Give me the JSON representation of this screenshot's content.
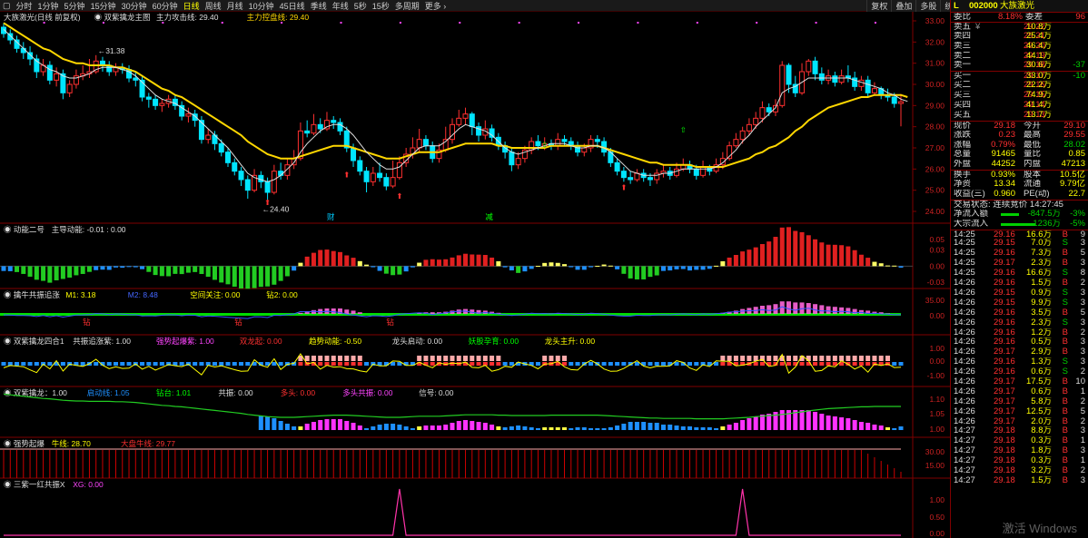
{
  "toolbar": {
    "items": [
      "▢",
      "分时",
      "1分钟",
      "5分钟",
      "15分钟",
      "30分钟",
      "60分钟",
      "日线",
      "周线",
      "月线",
      "10分钟",
      "45日线",
      "季线",
      "年线",
      "5秒",
      "15秒",
      "多周期",
      "更多 ›"
    ],
    "active": "日线",
    "right": [
      "复权",
      "叠加",
      "多股",
      "统计",
      "画线",
      "F10",
      "标记",
      "-自选",
      "返回"
    ]
  },
  "stock": {
    "marker": "L",
    "code": "002000",
    "name": "大族激光"
  },
  "panels": {
    "main": {
      "title": "大族激光(日线 前复权)",
      "legend": "◉ 双紫擒龙主图",
      "l1": "主力攻击线: 29.40",
      "l2": "主力控盘线: 29.40",
      "high": "31.38",
      "low": "24.40",
      "ticks": [
        "33.00",
        "32.00",
        "31.00",
        "30.00",
        "29.00",
        "28.00",
        "27.00",
        "26.00",
        "25.00",
        "24.00"
      ],
      "marks": [
        "财",
        "减"
      ]
    },
    "p2": {
      "title": "◉ 动能二号",
      "l1": "主导动能: -0.01 : 0.00",
      "ticks": [
        "0.05",
        "0.03",
        "0.00",
        "-0.03"
      ]
    },
    "p3": {
      "title": "◉ 擒牛共振追涨",
      "l1": "M1: 3.18",
      "l2": "M2: 8.48",
      "l3": "空间关注: 0.00",
      "l4": "钻2: 0.00",
      "ticks": [
        "35.00",
        "0.00"
      ],
      "flags": [
        "钻",
        "钻",
        "钻"
      ]
    },
    "p4": {
      "title": "◉ 双紫擒龙四合1",
      "l1": "共振追涨紫: 1.00",
      "l2": "强势起爆紫: 1.00",
      "l3": "双龙起: 0.00",
      "l4": "趋势动能: -0.50",
      "l5": "龙头启动: 0.00",
      "l6": "妖股孕育: 0.00",
      "l7": "龙头主升: 0.00",
      "ticks": [
        "1.00",
        "0.00",
        "-1.00"
      ]
    },
    "p5": {
      "title": "◉ 双紫擒龙：1.00",
      "l1": "启动线: 1.05",
      "l2": "钻台: 1.01",
      "l3": "共振: 0.00",
      "l4": "多头: 0.00",
      "l5": "多头共振: 0.00",
      "l6": "信号: 0.00",
      "ticks": [
        "1.10",
        "1.05",
        "1.00"
      ]
    },
    "p6": {
      "title": "◉ 强势起爆",
      "l1": "牛线: 28.70",
      "l2": "大盘牛线: 29.77",
      "ticks": [
        "30.00",
        "15.00"
      ]
    },
    "p7": {
      "title": "◉ 三紫一红共振X",
      "l1": "XG: 0.00",
      "ticks": [
        "1.00",
        "0.50",
        "0.00"
      ]
    }
  },
  "quote": {
    "weibi": [
      "委比",
      "8.18%",
      "委差",
      "96"
    ],
    "sell": [
      [
        "卖五",
        "¥",
        "29.22",
        "10.8万"
      ],
      [
        "卖四",
        "",
        "29.21",
        "25.4万"
      ],
      [
        "卖三",
        "",
        "29.20",
        "46.4万"
      ],
      [
        "卖二",
        "",
        "29.19",
        "44.1万"
      ],
      [
        "卖一",
        "",
        "29.18",
        "30.6万",
        "-37"
      ]
    ],
    "buy": [
      [
        "买一",
        "",
        "29.17",
        "33.0万",
        "-10"
      ],
      [
        "买二",
        "",
        "29.16",
        "22.2万"
      ],
      [
        "买三",
        "",
        "29.15",
        "74.9万"
      ],
      [
        "买四",
        "",
        "29.14",
        "41.4万"
      ],
      [
        "买五",
        "",
        "29.13",
        "13.7万"
      ]
    ],
    "stats": [
      [
        "现价",
        "29.18",
        "今开",
        "29.10"
      ],
      [
        "涨跌",
        "0.23",
        "最高",
        "29.55"
      ],
      [
        "涨幅",
        "0.79%",
        "最低",
        "28.02"
      ],
      [
        "总量",
        "91465",
        "量比",
        "0.85"
      ],
      [
        "外盘",
        "44252",
        "内盘",
        "47213"
      ],
      [
        "换手",
        "0.93%",
        "股本",
        "10.5亿"
      ],
      [
        "净资",
        "13.34",
        "流通",
        "9.79亿"
      ],
      [
        "收益(三)",
        "0.960",
        "PE(动)",
        "22.7"
      ]
    ],
    "status": "交易状态: 连续竞价 14:27:45",
    "flows": [
      [
        "净流入额",
        "-847.5万",
        "-3%"
      ],
      [
        "大宗流入",
        "-1236万",
        "-5%"
      ]
    ]
  },
  "ticks": [
    [
      "14:25",
      "29.16",
      "16.6万",
      "B",
      "9"
    ],
    [
      "14:25",
      "29.15",
      "7.0万",
      "S",
      "3"
    ],
    [
      "14:25",
      "29.16",
      "7.3万",
      "B",
      "5"
    ],
    [
      "14:25",
      "29.17",
      "2.3万",
      "B",
      "3"
    ],
    [
      "14:25",
      "29.16",
      "16.6万",
      "S",
      "8"
    ],
    [
      "14:26",
      "29.16",
      "1.5万",
      "B",
      "2"
    ],
    [
      "14:26",
      "29.15",
      "0.9万",
      "S",
      "3"
    ],
    [
      "14:26",
      "29.15",
      "9.9万",
      "S",
      "3"
    ],
    [
      "14:26",
      "29.16",
      "3.5万",
      "B",
      "5"
    ],
    [
      "14:26",
      "29.16",
      "2.3万",
      "S",
      "3"
    ],
    [
      "14:26",
      "29.16",
      "1.2万",
      "B",
      "2"
    ],
    [
      "14:26",
      "29.16",
      "0.5万",
      "B",
      "3"
    ],
    [
      "14:26",
      "29.17",
      "2.9万",
      "B",
      "3"
    ],
    [
      "14:26",
      "29.16",
      "1.3万",
      "S",
      "3"
    ],
    [
      "14:26",
      "29.16",
      "0.6万",
      "S",
      "2"
    ],
    [
      "14:26",
      "29.17",
      "17.5万",
      "B",
      "10"
    ],
    [
      "14:26",
      "29.17",
      "0.6万",
      "B",
      "1"
    ],
    [
      "14:26",
      "29.17",
      "5.8万",
      "B",
      "2"
    ],
    [
      "14:26",
      "29.17",
      "12.5万",
      "B",
      "5"
    ],
    [
      "14:26",
      "29.17",
      "2.0万",
      "B",
      "2"
    ],
    [
      "14:27",
      "29.18",
      "8.8万",
      "B",
      "3"
    ],
    [
      "14:27",
      "29.18",
      "0.3万",
      "B",
      "1"
    ],
    [
      "14:27",
      "29.18",
      "1.8万",
      "B",
      "3"
    ],
    [
      "14:27",
      "29.18",
      "0.3万",
      "B",
      "1"
    ],
    [
      "14:27",
      "29.18",
      "3.2万",
      "B",
      "2"
    ],
    [
      "14:27",
      "29.18",
      "1.5万",
      "B",
      "3"
    ]
  ],
  "watermark": "激活 Windows",
  "chart_data": {
    "type": "candlestick",
    "ylim": [
      24,
      33
    ],
    "candles": [
      [
        32.7,
        32.4,
        32.9,
        32.2
      ],
      [
        32.4,
        32.1,
        32.6,
        31.9
      ],
      [
        32.1,
        31.7,
        32.3,
        31.5
      ],
      [
        31.7,
        31.5,
        32.0,
        31.2
      ],
      [
        31.5,
        31.2,
        31.8,
        30.9
      ],
      [
        31.2,
        30.6,
        31.4,
        30.3
      ],
      [
        30.6,
        30.9,
        31.2,
        30.4
      ],
      [
        30.9,
        30.2,
        31.1,
        30.0
      ],
      [
        30.2,
        30.5,
        30.8,
        29.9
      ],
      [
        30.5,
        29.6,
        30.7,
        29.3
      ],
      [
        29.6,
        30.0,
        30.2,
        29.4
      ],
      [
        30.0,
        30.4,
        30.7,
        29.8
      ],
      [
        30.4,
        30.5,
        30.9,
        30.2
      ],
      [
        30.5,
        30.6,
        31.2,
        30.3
      ],
      [
        30.6,
        31.1,
        31.38,
        30.5
      ],
      [
        31.1,
        30.9,
        31.3,
        30.6
      ],
      [
        30.9,
        30.6,
        31.1,
        30.4
      ],
      [
        30.6,
        30.8,
        31.0,
        30.4
      ],
      [
        30.8,
        30.7,
        31.0,
        30.5
      ],
      [
        30.7,
        30.3,
        30.9,
        30.1
      ],
      [
        30.3,
        30.2,
        30.6,
        29.9
      ],
      [
        30.2,
        29.4,
        30.4,
        29.2
      ],
      [
        29.4,
        29.3,
        29.6,
        28.9
      ],
      [
        29.3,
        29.0,
        29.5,
        28.8
      ],
      [
        29.0,
        29.1,
        29.3,
        28.7
      ],
      [
        29.1,
        29.3,
        29.5,
        28.9
      ],
      [
        29.3,
        29.0,
        29.5,
        28.8
      ],
      [
        29.0,
        28.5,
        29.2,
        28.3
      ],
      [
        28.5,
        28.6,
        28.9,
        28.2
      ],
      [
        28.6,
        28.3,
        28.8,
        28.0
      ],
      [
        28.3,
        27.4,
        28.5,
        27.2
      ],
      [
        27.4,
        27.6,
        27.9,
        27.2
      ],
      [
        27.6,
        27.2,
        27.8,
        26.9
      ],
      [
        27.2,
        26.8,
        27.4,
        26.6
      ],
      [
        26.8,
        26.3,
        27.0,
        26.1
      ],
      [
        26.3,
        25.9,
        26.5,
        25.7
      ],
      [
        25.9,
        25.5,
        26.1,
        25.2
      ],
      [
        25.5,
        25.0,
        25.7,
        24.6
      ],
      [
        25.0,
        25.7,
        26.0,
        24.9
      ],
      [
        25.7,
        25.4,
        25.9,
        25.1
      ],
      [
        25.4,
        24.9,
        25.6,
        24.4
      ],
      [
        24.9,
        25.9,
        26.2,
        24.8
      ],
      [
        25.9,
        25.7,
        26.3,
        25.5
      ],
      [
        25.7,
        26.2,
        26.5,
        25.5
      ],
      [
        26.2,
        26.5,
        26.9,
        26.0
      ],
      [
        26.5,
        27.8,
        28.2,
        26.4
      ],
      [
        27.8,
        27.7,
        28.3,
        27.5
      ],
      [
        27.7,
        28.1,
        28.6,
        27.6
      ],
      [
        28.1,
        27.9,
        28.4,
        27.7
      ],
      [
        27.9,
        28.3,
        28.7,
        27.8
      ],
      [
        28.3,
        28.2,
        28.5,
        27.9
      ],
      [
        28.2,
        27.8,
        28.4,
        27.6
      ],
      [
        27.8,
        27.0,
        28.0,
        26.8
      ],
      [
        27.0,
        26.4,
        27.2,
        26.1
      ],
      [
        26.4,
        25.9,
        26.6,
        25.7
      ],
      [
        25.9,
        25.4,
        26.1,
        24.9
      ],
      [
        25.4,
        25.8,
        26.1,
        25.2
      ],
      [
        25.8,
        25.6,
        26.3,
        25.4
      ],
      [
        25.6,
        25.2,
        25.8,
        25.0
      ],
      [
        25.2,
        25.6,
        26.4,
        25.1
      ],
      [
        25.6,
        26.3,
        26.6,
        25.5
      ],
      [
        26.3,
        26.7,
        27.0,
        26.1
      ],
      [
        26.7,
        27.0,
        27.5,
        26.5
      ],
      [
        27.0,
        27.4,
        27.9,
        26.8
      ],
      [
        27.4,
        27.1,
        27.6,
        26.9
      ],
      [
        27.1,
        26.5,
        27.3,
        26.3
      ],
      [
        26.5,
        26.9,
        27.2,
        26.3
      ],
      [
        26.9,
        27.4,
        28.0,
        26.8
      ],
      [
        27.4,
        28.1,
        28.4,
        27.2
      ],
      [
        28.1,
        28.4,
        28.8,
        28.0
      ],
      [
        28.4,
        28.6,
        28.9,
        28.1
      ],
      [
        28.6,
        28.0,
        28.7,
        27.6
      ],
      [
        28.0,
        27.6,
        28.2,
        27.3
      ],
      [
        27.6,
        27.9,
        28.3,
        27.4
      ],
      [
        27.9,
        27.5,
        28.1,
        27.3
      ],
      [
        27.5,
        27.1,
        27.7,
        26.9
      ],
      [
        27.1,
        26.8,
        27.3,
        26.5
      ],
      [
        26.8,
        26.2,
        27.0,
        25.9
      ],
      [
        26.2,
        26.5,
        26.8,
        26.0
      ],
      [
        26.5,
        26.9,
        27.1,
        26.3
      ],
      [
        26.9,
        27.3,
        27.5,
        26.7
      ],
      [
        27.3,
        27.1,
        27.6,
        26.9
      ],
      [
        27.1,
        27.2,
        27.5,
        26.9
      ],
      [
        27.2,
        27.1,
        27.4,
        26.9
      ],
      [
        27.1,
        27.4,
        27.7,
        26.9
      ],
      [
        27.4,
        27.3,
        27.6,
        27.1
      ],
      [
        27.3,
        27.1,
        27.5,
        26.9
      ],
      [
        27.1,
        26.8,
        27.3,
        26.6
      ],
      [
        26.8,
        27.0,
        27.2,
        26.6
      ],
      [
        27.0,
        27.4,
        27.6,
        26.8
      ],
      [
        27.4,
        27.3,
        27.6,
        27.0
      ],
      [
        27.3,
        26.8,
        27.5,
        26.6
      ],
      [
        26.8,
        26.3,
        27.0,
        26.1
      ],
      [
        26.3,
        25.9,
        26.5,
        25.7
      ],
      [
        25.9,
        25.6,
        26.1,
        25.4
      ],
      [
        25.6,
        25.5,
        25.9,
        25.3
      ],
      [
        25.5,
        25.8,
        26.0,
        25.4
      ],
      [
        25.8,
        25.6,
        26.0,
        25.4
      ],
      [
        25.6,
        25.5,
        25.8,
        25.2
      ],
      [
        25.5,
        25.8,
        26.0,
        25.3
      ],
      [
        25.8,
        25.9,
        26.2,
        25.6
      ],
      [
        25.9,
        25.7,
        26.1,
        25.5
      ],
      [
        25.7,
        26.0,
        26.3,
        25.6
      ],
      [
        26.0,
        26.2,
        26.5,
        25.9
      ],
      [
        26.2,
        26.0,
        26.4,
        25.8
      ],
      [
        26.0,
        25.7,
        26.2,
        25.5
      ],
      [
        25.7,
        26.1,
        26.4,
        25.6
      ],
      [
        26.1,
        25.9,
        26.2,
        25.7
      ],
      [
        25.9,
        26.2,
        26.5,
        25.8
      ],
      [
        26.2,
        26.5,
        26.8,
        26.0
      ],
      [
        26.5,
        27.1,
        27.3,
        26.4
      ],
      [
        27.1,
        27.4,
        27.7,
        27.0
      ],
      [
        27.4,
        27.8,
        28.0,
        27.2
      ],
      [
        27.8,
        28.1,
        28.4,
        27.6
      ],
      [
        28.1,
        28.4,
        28.7,
        27.9
      ],
      [
        28.4,
        28.9,
        29.2,
        28.2
      ],
      [
        28.9,
        28.7,
        29.1,
        28.5
      ],
      [
        28.7,
        29.0,
        29.3,
        28.5
      ],
      [
        29.0,
        30.9,
        31.1,
        28.9
      ],
      [
        30.9,
        30.0,
        31.0,
        29.6
      ],
      [
        30.0,
        29.6,
        30.4,
        29.4
      ],
      [
        29.6,
        30.6,
        31.0,
        29.5
      ],
      [
        30.6,
        31.1,
        31.2,
        30.4
      ],
      [
        31.1,
        30.5,
        31.3,
        30.2
      ],
      [
        30.5,
        30.2,
        30.8,
        30.0
      ],
      [
        30.2,
        30.4,
        30.7,
        30.0
      ],
      [
        30.4,
        30.1,
        30.6,
        29.9
      ],
      [
        30.1,
        30.4,
        30.7,
        30.0
      ],
      [
        30.4,
        30.3,
        30.9,
        30.1
      ],
      [
        30.3,
        29.9,
        30.6,
        29.7
      ],
      [
        29.9,
        30.2,
        30.4,
        29.7
      ],
      [
        30.2,
        29.6,
        30.4,
        29.4
      ],
      [
        29.6,
        29.8,
        30.1,
        29.5
      ],
      [
        29.8,
        29.5,
        29.9,
        29.3
      ],
      [
        29.5,
        29.4,
        29.8,
        29.2
      ],
      [
        29.4,
        29.1,
        29.6,
        28.9
      ],
      [
        29.1,
        29.18,
        29.55,
        28.02
      ]
    ],
    "ma_slow": [
      32.9,
      32.7,
      32.5,
      32.3,
      32.1,
      31.9,
      31.7,
      31.6,
      31.4,
      31.2,
      31.1,
      31.0,
      31.0,
      30.9,
      30.9,
      30.9,
      30.9,
      30.8,
      30.8,
      30.7,
      30.6,
      30.4,
      30.2,
      30.0,
      29.8,
      29.7,
      29.5,
      29.4,
      29.2,
      29.0,
      28.8,
      28.6,
      28.4,
      28.2,
      28.0,
      27.8,
      27.6,
      27.3,
      27.1,
      26.9,
      26.7,
      26.6,
      26.5,
      26.5,
      26.5,
      26.6,
      26.7,
      26.8,
      26.9,
      27.0,
      27.1,
      27.1,
      27.1,
      27.0,
      26.9,
      26.8,
      26.7,
      26.6,
      26.5,
      26.5,
      26.5,
      26.6,
      26.7,
      26.8,
      26.8,
      26.8,
      26.8,
      26.9,
      27.0,
      27.1,
      27.2,
      27.2,
      27.2,
      27.2,
      27.2,
      27.1,
      27.1,
      27.0,
      27.0,
      27.0,
      27.0,
      27.0,
      27.0,
      27.1,
      27.1,
      27.1,
      27.1,
      27.1,
      27.1,
      27.1,
      27.1,
      27.0,
      26.9,
      26.8,
      26.7,
      26.6,
      26.5,
      26.4,
      26.3,
      26.3,
      26.2,
      26.2,
      26.2,
      26.2,
      26.2,
      26.1,
      26.1,
      26.1,
      26.1,
      26.1,
      26.2,
      26.3,
      26.4,
      26.5,
      26.7,
      26.8,
      27.0,
      27.1,
      27.3,
      27.5,
      27.8,
      28.0,
      28.3,
      28.5,
      28.7,
      28.9,
      29.0,
      29.1,
      29.2,
      29.3,
      29.4,
      29.4,
      29.5,
      29.5,
      29.5,
      29.5,
      29.5,
      29.4
    ],
    "ma_fast": [
      32.6,
      32.3,
      32.0,
      31.7,
      31.4,
      31.1,
      30.9,
      30.7,
      30.6,
      30.4,
      30.3,
      30.3,
      30.4,
      30.5,
      30.7,
      30.8,
      30.8,
      30.8,
      30.7,
      30.6,
      30.4,
      30.1,
      29.8,
      29.5,
      29.3,
      29.2,
      29.1,
      28.9,
      28.7,
      28.5,
      28.2,
      27.9,
      27.6,
      27.3,
      27.0,
      26.6,
      26.2,
      25.8,
      25.6,
      25.5,
      25.4,
      25.5,
      25.7,
      26.0,
      26.3,
      26.8,
      27.2,
      27.5,
      27.8,
      28.0,
      28.1,
      28.1,
      27.9,
      27.6,
      27.2,
      26.8,
      26.5,
      26.2,
      26.0,
      26.0,
      26.1,
      26.4,
      26.7,
      27.0,
      27.1,
      27.1,
      27.1,
      27.3,
      27.6,
      27.9,
      28.1,
      28.0,
      27.9,
      27.8,
      27.6,
      27.3,
      27.0,
      26.8,
      26.7,
      26.8,
      26.9,
      27.0,
      27.1,
      27.2,
      27.2,
      27.2,
      27.1,
      27.0,
      27.0,
      27.1,
      27.1,
      27.0,
      26.8,
      26.5,
      26.2,
      25.9,
      25.8,
      25.7,
      25.7,
      25.7,
      25.8,
      25.8,
      25.9,
      26.0,
      26.0,
      26.0,
      26.0,
      26.0,
      26.1,
      26.3,
      26.6,
      26.9,
      27.3,
      27.6,
      28.0,
      28.3,
      28.6,
      28.9,
      29.6,
      29.8,
      29.9,
      30.1,
      30.3,
      30.3,
      30.3,
      30.3,
      30.3,
      30.3,
      30.3,
      30.2,
      30.1,
      30.0,
      29.9,
      29.8,
      29.6,
      29.5,
      29.3,
      29.2
    ]
  }
}
